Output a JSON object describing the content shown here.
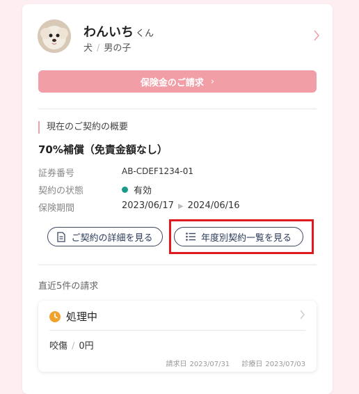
{
  "pet": {
    "name": "わんいち",
    "suffix": "くん",
    "species": "犬",
    "gender": "男の子"
  },
  "claim_button": {
    "label": "保険金のご請求",
    "arrow": "›"
  },
  "contract": {
    "section_title": "現在のご契約の概要",
    "plan": "70%補償（免責金額なし）",
    "policy_number_label": "証券番号",
    "policy_number": "AB-CDEF1234-01",
    "status_label": "契約の状態",
    "status": "有効",
    "status_color": "#1a9a8b",
    "period_label": "保険期間",
    "period_start": "2023/06/17",
    "period_end": "2024/06/16"
  },
  "buttons": {
    "details": "ご契約の詳細を見る",
    "yearly_list": "年度別契約一覧を見る"
  },
  "recent": {
    "label": "直近5件の請求",
    "claims": [
      {
        "status": "処理中",
        "injury": "咬傷",
        "amount": "0円",
        "claim_date_label": "請求日",
        "claim_date": "2023/07/31",
        "visit_date_label": "診療日",
        "visit_date": "2023/07/03"
      }
    ]
  },
  "colors": {
    "accent": "#f29ea6",
    "highlight": "#e0191f",
    "processing": "#f0a32c"
  }
}
